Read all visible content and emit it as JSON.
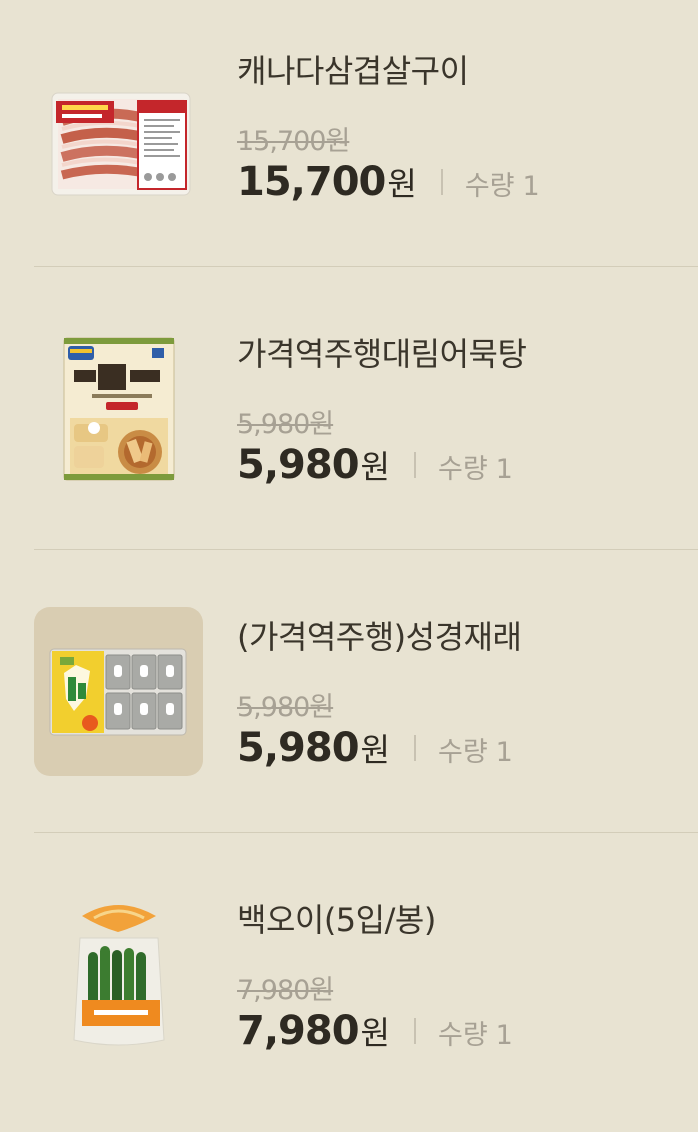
{
  "cart": {
    "currency_suffix": "원",
    "quantity_label": "수량",
    "items": [
      {
        "name": "캐나다삼겹살구이",
        "original_price": "15,700원",
        "price": "15,700",
        "quantity": "1"
      },
      {
        "name": "가격역주행대림어묵탕",
        "original_price": "5,980원",
        "price": "5,980",
        "quantity": "1"
      },
      {
        "name": "(가격역주행)성경재래",
        "original_price": "5,980원",
        "price": "5,980",
        "quantity": "1"
      },
      {
        "name": "백오이(5입/봉)",
        "original_price": "7,980원",
        "price": "7,980",
        "quantity": "1"
      }
    ]
  },
  "colors": {
    "background": "#e8e3d2",
    "text_primary": "#2e2a22",
    "text_muted": "#a7a194",
    "divider": "#d3cdb9"
  }
}
